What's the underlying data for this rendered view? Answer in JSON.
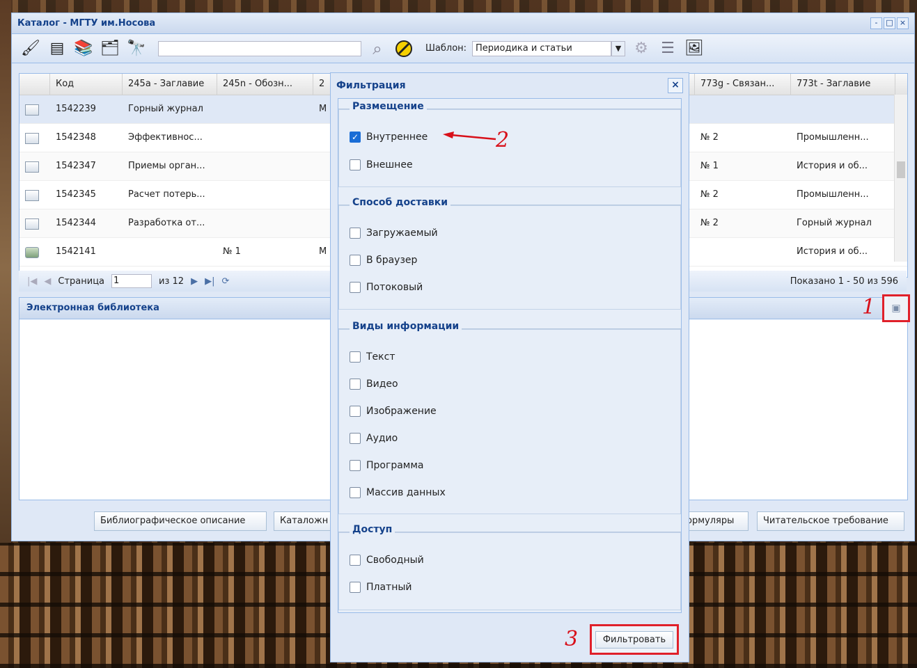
{
  "window": {
    "title": "Каталог - МГТУ им.Носова",
    "tools": [
      "-",
      "□",
      "×"
    ]
  },
  "toolbar": {
    "icons": [
      "brush-icon",
      "form-icon",
      "books-icon",
      "table-star-icon",
      "binoculars-icon"
    ],
    "search_placeholder": "",
    "template_label": "Шаблон:",
    "template_value": "Периодика и статьи"
  },
  "grid": {
    "columns": [
      "",
      "Код",
      "245a - Заглавие",
      "245n - Обозн...",
      "2",
      "773g - Связан...",
      "773t - Заглавие"
    ],
    "rows": [
      {
        "code": "1542239",
        "title": "Горный журнал",
        "num": "",
        "m": "M",
        "link": "",
        "jtitle": ""
      },
      {
        "code": "1542348",
        "title": "Эффективнос...",
        "num": "",
        "m": "",
        "link": "№ 2",
        "jtitle": "Промышленн..."
      },
      {
        "code": "1542347",
        "title": "Приемы орган...",
        "num": "",
        "m": "",
        "link": "№ 1",
        "jtitle": "История и об..."
      },
      {
        "code": "1542345",
        "title": "Расчет потерь...",
        "num": "",
        "m": "",
        "link": "№ 2",
        "jtitle": "Промышленн..."
      },
      {
        "code": "1542344",
        "title": "Разработка от...",
        "num": "",
        "m": "",
        "link": "№ 2",
        "jtitle": "Горный журнал"
      },
      {
        "code": "1542141",
        "title": "",
        "num": "№ 1",
        "m": "M",
        "link": "",
        "jtitle": "История и об..."
      }
    ]
  },
  "pager": {
    "page_label": "Страница",
    "page_value": "1",
    "of_label": "из 12",
    "info": "Показано 1 - 50 из 596"
  },
  "panel": {
    "title": "Электронная библиотека"
  },
  "bottom_tabs": {
    "bib": "Библиографическое описание",
    "cat": "Каталожн",
    "forms": "ормуляры",
    "reader": "Читательское требование"
  },
  "markers": {
    "one": "1",
    "two": "2",
    "three": "3"
  },
  "dialog": {
    "title": "Фильтрация",
    "close": "×",
    "button": "Фильтровать",
    "sections": {
      "placement": {
        "legend": "Размещение",
        "items": [
          {
            "label": "Внутреннее",
            "checked": true
          },
          {
            "label": "Внешнее",
            "checked": false
          }
        ]
      },
      "delivery": {
        "legend": "Способ доставки",
        "items": [
          {
            "label": "Загружаемый"
          },
          {
            "label": "В браузер"
          },
          {
            "label": "Потоковый"
          }
        ]
      },
      "info_types": {
        "legend": "Виды информации",
        "items": [
          {
            "label": "Текст"
          },
          {
            "label": "Видео"
          },
          {
            "label": "Изображение"
          },
          {
            "label": "Аудио"
          },
          {
            "label": "Программа"
          },
          {
            "label": "Массив данных"
          }
        ]
      },
      "access": {
        "legend": "Доступ",
        "items": [
          {
            "label": "Свободный"
          },
          {
            "label": "Платный"
          }
        ]
      }
    }
  },
  "colors": {
    "accent": "#15428b",
    "highlight": "#e0202a",
    "panel": "#dfe8f6"
  }
}
